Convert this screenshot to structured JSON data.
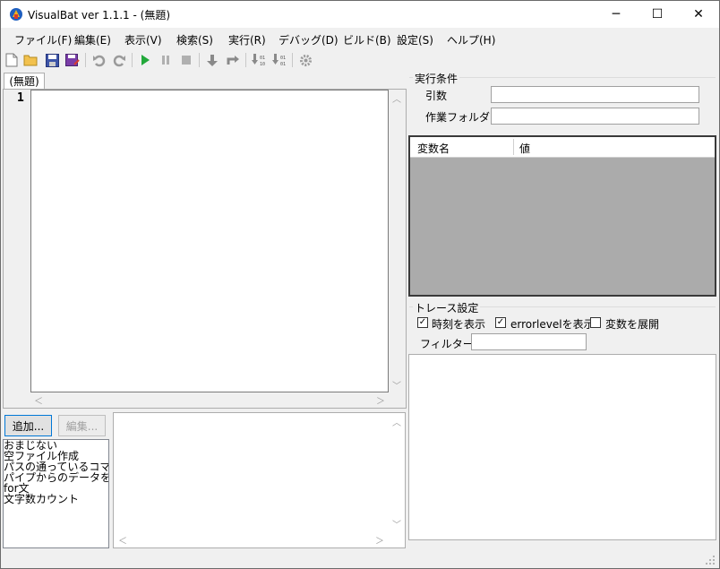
{
  "window": {
    "title": "VisualBat ver 1.1.1 - (無題)",
    "controls": {
      "minimize": "─",
      "maximize": "☐",
      "close": "✕"
    }
  },
  "menu": [
    "ファイル(F)",
    "編集(E)",
    "表示(V)",
    "検索(S)",
    "実行(R)",
    "デバッグ(D)",
    "ビルド(B)",
    "設定(S)",
    "ヘルプ(H)"
  ],
  "toolbar_icons": [
    "new-file-icon",
    "open-folder-icon",
    "save-icon",
    "save-as-icon",
    "undo-icon",
    "redo-icon",
    "run-icon",
    "pause-icon",
    "stop-icon",
    "step-into-icon",
    "step-over-icon",
    "step-binary-icon",
    "step-binary-out-icon",
    "settings-icon"
  ],
  "editor": {
    "tab_label": "(無題)",
    "line_number": "1",
    "content": ""
  },
  "snippets": {
    "add_button": "追加...",
    "edit_button": "編集...",
    "items": [
      "おまじない",
      "空ファイル作成",
      "パスの通っているコマ",
      "パイプからのデータを",
      "for文",
      "文字数カウント"
    ]
  },
  "run_conditions": {
    "group_title": "実行条件",
    "args_label": "引数",
    "args_value": "",
    "workdir_label": "作業フォルダ",
    "workdir_value": ""
  },
  "variables": {
    "col_name": "変数名",
    "col_value": "値"
  },
  "trace": {
    "group_title": "トレース設定",
    "show_time_label": "時刻を表示",
    "show_time_checked": true,
    "show_errorlevel_label": "errorlevelを表示",
    "show_errorlevel_checked": true,
    "expand_vars_label": "変数を展開",
    "expand_vars_checked": false,
    "filter_label": "フィルター:",
    "filter_value": ""
  },
  "colors": {
    "grid_bg": "#ababab",
    "accent_green": "#22a83a",
    "accent_blue": "#1f5fbf"
  }
}
